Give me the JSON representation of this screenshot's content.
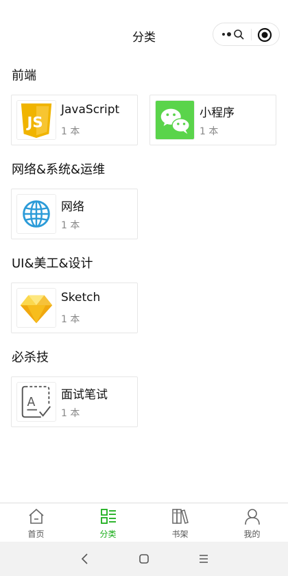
{
  "header": {
    "title": "分类"
  },
  "capsule": {
    "more_icon": "ellipsis-icon",
    "close_icon": "target-icon"
  },
  "sections": [
    {
      "title": "前端",
      "items": [
        {
          "name": "JavaScript",
          "count": "1 本",
          "icon": "js-logo-icon"
        },
        {
          "name": "小程序",
          "count": "1 本",
          "icon": "wechat-logo-icon"
        }
      ]
    },
    {
      "title": "网络&系统&运维",
      "items": [
        {
          "name": "网络",
          "count": "1 本",
          "icon": "globe-icon"
        }
      ]
    },
    {
      "title": "UI&美工&设计",
      "items": [
        {
          "name": "Sketch",
          "count": "1 本",
          "icon": "sketch-diamond-icon"
        }
      ]
    },
    {
      "title": "必杀技",
      "items": [
        {
          "name": "面试笔试",
          "count": "1 本",
          "icon": "exam-answer-icon"
        }
      ]
    }
  ],
  "tabbar": {
    "active_index": 1,
    "active_color": "#1aad19",
    "tabs": [
      {
        "label": "首页",
        "icon": "home-icon"
      },
      {
        "label": "分类",
        "icon": "category-icon"
      },
      {
        "label": "书架",
        "icon": "bookshelf-icon"
      },
      {
        "label": "我的",
        "icon": "user-icon"
      }
    ]
  },
  "system_nav": {
    "buttons": [
      "back-icon",
      "home-square-icon",
      "menu-icon"
    ]
  }
}
